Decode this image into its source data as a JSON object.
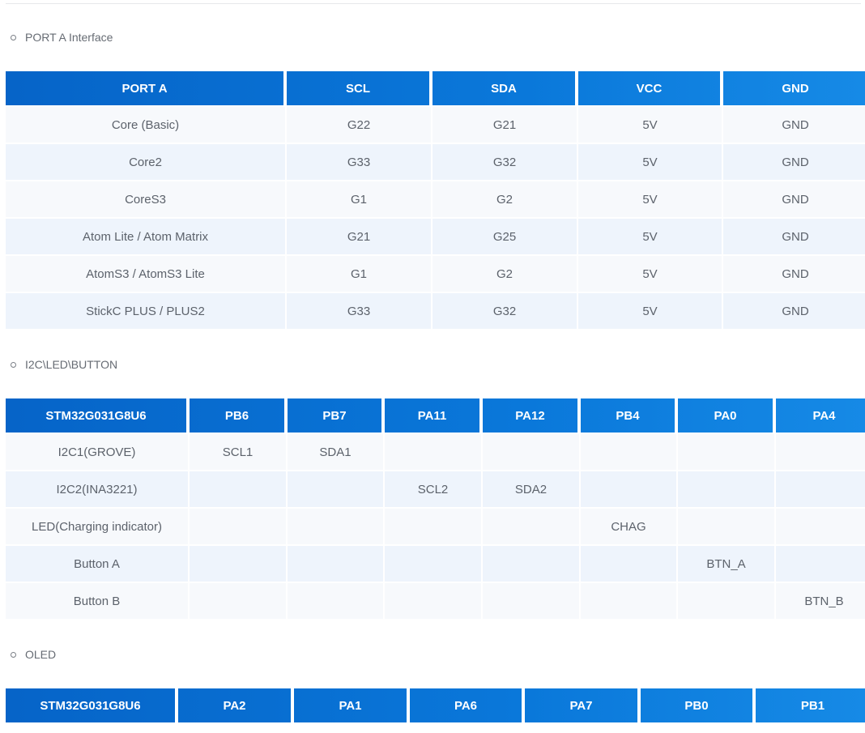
{
  "sections": {
    "port_a": {
      "bullet": "PORT A Interface",
      "headers": [
        "PORT A",
        "SCL",
        "SDA",
        "VCC",
        "GND"
      ],
      "rows": [
        [
          "Core (Basic)",
          "G22",
          "G21",
          "5V",
          "GND"
        ],
        [
          "Core2",
          "G33",
          "G32",
          "5V",
          "GND"
        ],
        [
          "CoreS3",
          "G1",
          "G2",
          "5V",
          "GND"
        ],
        [
          "Atom Lite / Atom Matrix",
          "G21",
          "G25",
          "5V",
          "GND"
        ],
        [
          "AtomS3 / AtomS3 Lite",
          "G1",
          "G2",
          "5V",
          "GND"
        ],
        [
          "StickC PLUS / PLUS2",
          "G33",
          "G32",
          "5V",
          "GND"
        ]
      ]
    },
    "i2c_led_button": {
      "bullet": "I2C\\LED\\BUTTON",
      "headers": [
        "STM32G031G8U6",
        "PB6",
        "PB7",
        "PA11",
        "PA12",
        "PB4",
        "PA0",
        "PA4"
      ],
      "rows": [
        [
          "I2C1(GROVE)",
          "SCL1",
          "SDA1",
          "",
          "",
          "",
          "",
          ""
        ],
        [
          "I2C2(INA3221)",
          "",
          "",
          "SCL2",
          "SDA2",
          "",
          "",
          ""
        ],
        [
          "LED(Charging indicator)",
          "",
          "",
          "",
          "",
          "CHAG",
          "",
          ""
        ],
        [
          "Button A",
          "",
          "",
          "",
          "",
          "",
          "BTN_A",
          ""
        ],
        [
          "Button B",
          "",
          "",
          "",
          "",
          "",
          "",
          "BTN_B"
        ]
      ]
    },
    "oled": {
      "bullet": "OLED",
      "headers": [
        "STM32G031G8U6",
        "PA2",
        "PA1",
        "PA6",
        "PA7",
        "PB0",
        "PB1"
      ]
    }
  },
  "colors": {
    "header_start": "#0664c8",
    "header_end": "#168ae6",
    "row_odd": "#f7f9fc",
    "row_even": "#eef4fc"
  }
}
